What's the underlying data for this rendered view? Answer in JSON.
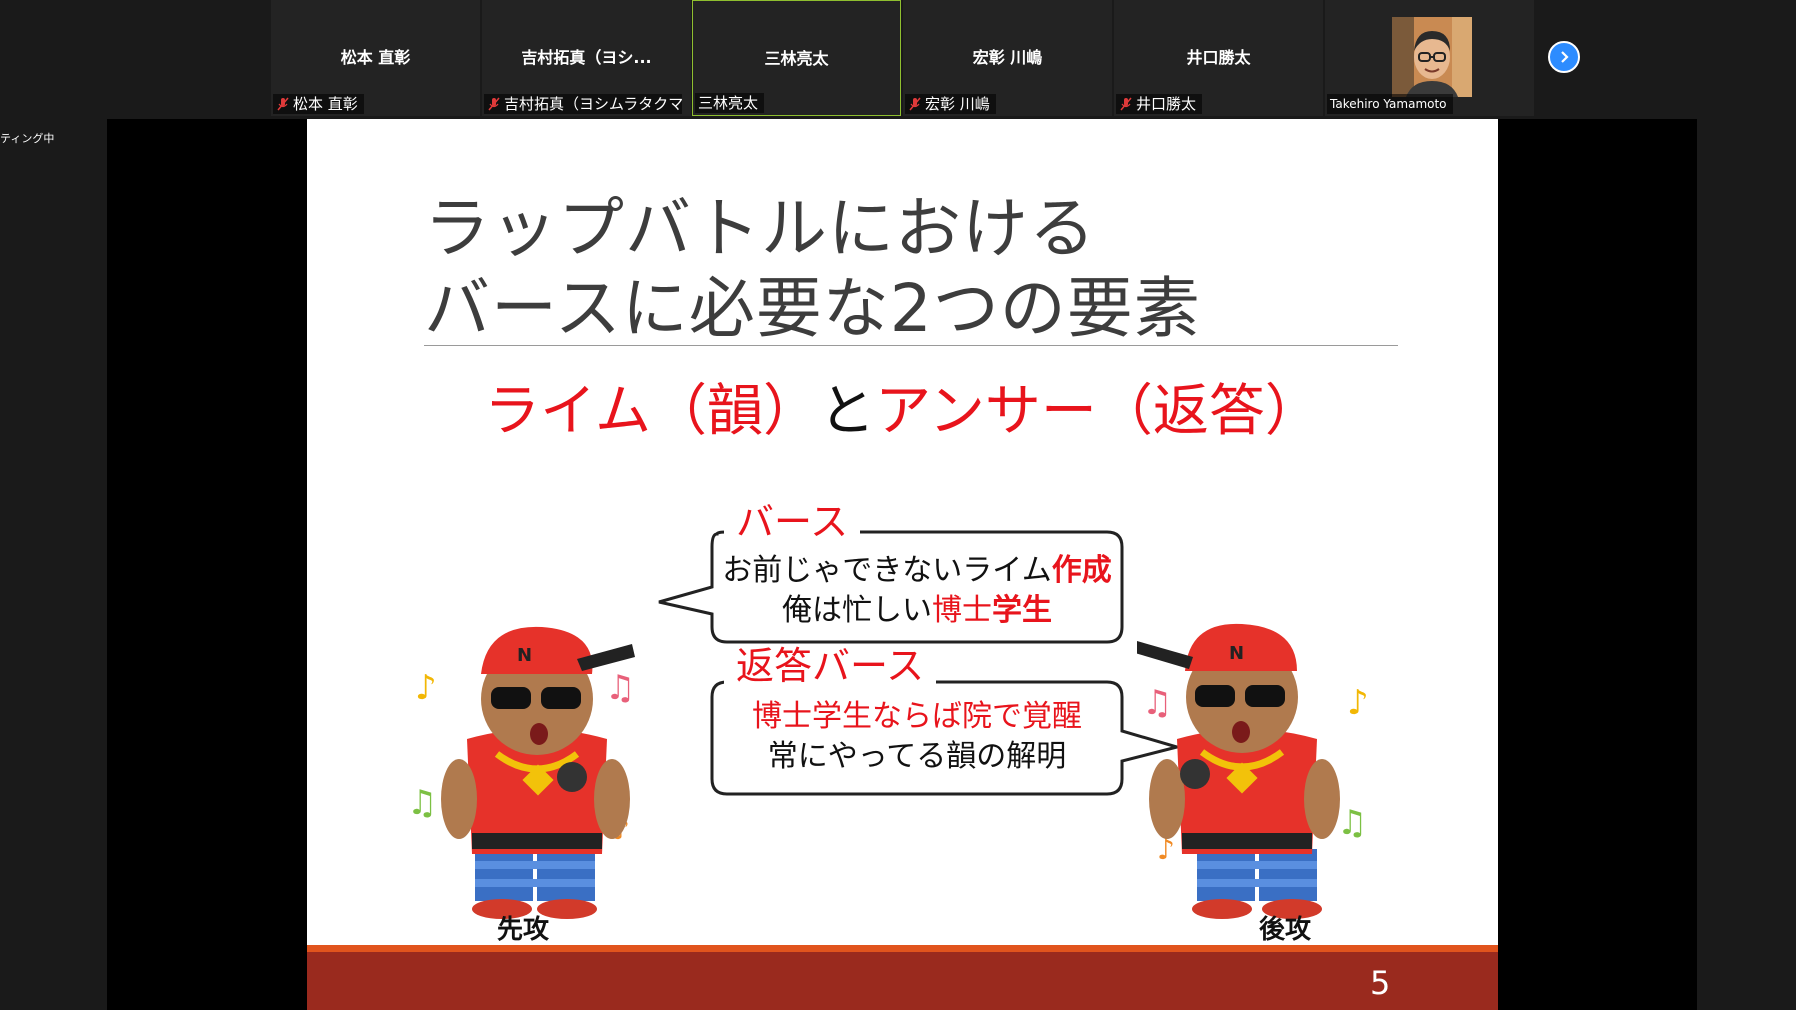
{
  "participants": [
    {
      "display": "松本 直彰",
      "label": "松本 直彰",
      "muted": true
    },
    {
      "display": "吉村拓真（ヨシ...",
      "label": "吉村拓真（ヨシムラタクマ）",
      "muted": true
    },
    {
      "display": "三林亮太",
      "label": "三林亮太",
      "muted": false,
      "active": true
    },
    {
      "display": "宏彰 川嶋",
      "label": "宏彰 川嶋",
      "muted": true
    },
    {
      "display": "井口勝太",
      "label": "井口勝太",
      "muted": true
    },
    {
      "display": "",
      "label": "Takehiro Yamamoto",
      "muted": false,
      "video": true
    }
  ],
  "status_text": "ティング中",
  "slide": {
    "title_line1": "ラップバトルにおける",
    "title_line2": "バースに必要な2つの要素",
    "sub_part1": "ライム（韻）",
    "sub_part2": "と",
    "sub_part3": "アンサー（返答）",
    "verse_label": "バース",
    "verse_line1_a": "お前じゃできないライム",
    "verse_line1_b": "作成",
    "verse_line2_a": "俺は忙しい",
    "verse_line2_b": "博士",
    "verse_line2_c": "学生",
    "answer_label": "返答バース",
    "answer_line1": "博士学生ならば院で覚醒",
    "answer_line2": "常にやってる韻の解明",
    "left_caption": "先攻",
    "right_caption": "後攻",
    "page_number": "5"
  },
  "colors": {
    "accent_red": "#e8141c",
    "footer": "#9a2a1e",
    "footer_accent": "#e1541d",
    "active_border": "#8fbf2f",
    "next_button": "#2d8cff"
  }
}
